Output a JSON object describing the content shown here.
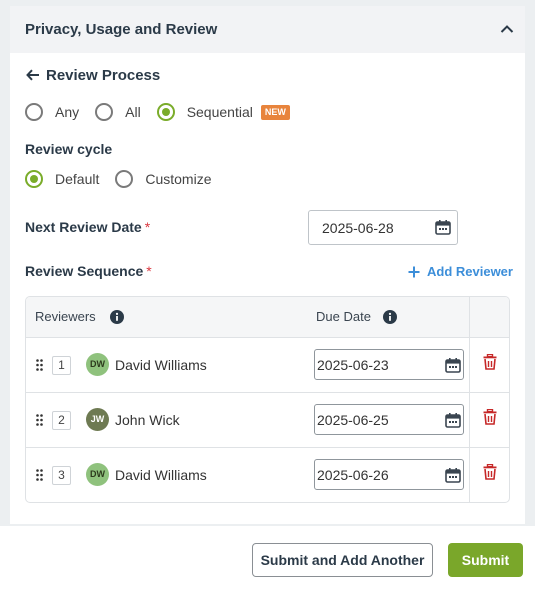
{
  "panel": {
    "title": "Privacy, Usage and Review",
    "collapse_icon": "chevron-up-icon"
  },
  "review_process": {
    "back_label": "Review Process",
    "back_icon": "arrow-left-icon",
    "options": [
      {
        "label": "Any",
        "checked": false
      },
      {
        "label": "All",
        "checked": false
      },
      {
        "label": "Sequential",
        "checked": true,
        "badge": "NEW"
      }
    ]
  },
  "review_cycle": {
    "label": "Review cycle",
    "options": [
      {
        "label": "Default",
        "checked": true
      },
      {
        "label": "Customize",
        "checked": false
      }
    ]
  },
  "next_review": {
    "label": "Next Review Date",
    "required_mark": "*",
    "value": "2025-06-28"
  },
  "sequence": {
    "label": "Review Sequence",
    "required_mark": "*",
    "add_label": "Add Reviewer",
    "columns": [
      "Reviewers",
      "Due Date"
    ],
    "rows": [
      {
        "order": "1",
        "initials": "DW",
        "name": "David Williams",
        "due": "2025-06-23",
        "avatar_color": "#8fc27d"
      },
      {
        "order": "2",
        "initials": "JW",
        "name": "John Wick",
        "due": "2025-06-25",
        "avatar_color": "#6e7a52"
      },
      {
        "order": "3",
        "initials": "DW",
        "name": "David Williams",
        "due": "2025-06-26",
        "avatar_color": "#8fc27d"
      }
    ]
  },
  "footer": {
    "secondary_label": "Submit and Add Another",
    "primary_label": "Submit"
  },
  "colors": {
    "accent_green": "#7aa72a",
    "link_blue": "#3c8ed9",
    "badge_orange": "#e8843c",
    "danger_red": "#c62828"
  }
}
